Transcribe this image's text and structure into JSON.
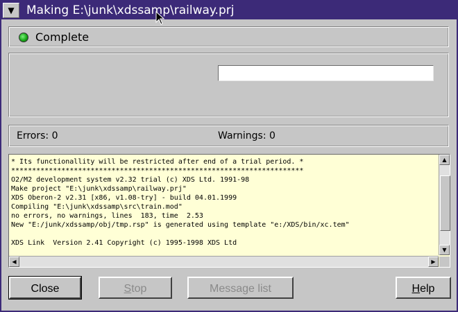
{
  "window": {
    "title": "Making E:\\junk\\xdssamp\\railway.prj"
  },
  "status": {
    "label": "Complete",
    "indicator_color": "#18a818"
  },
  "progress": {
    "fraction": 0
  },
  "counts": {
    "errors": "Errors: 0",
    "warnings": "Warnings: 0"
  },
  "log": {
    "lines": [
      "* Its functionallity will be restricted after end of a trial period. *",
      "**********************************************************************",
      "O2/M2 development system v2.32 trial (c) XDS Ltd. 1991-98",
      "Make project \"E:\\junk\\xdssamp\\railway.prj\"",
      "XDS Oberon-2 v2.31 [x86, v1.08-try] - build 04.01.1999",
      "Compiling \"E:\\junk\\xdssamp\\src\\train.mod\"",
      "no errors, no warnings, lines  183, time  2.53",
      "New \"E:/junk/xdssamp/obj/tmp.rsp\" is generated using template \"e:/XDS/bin/xc.tem\"",
      "",
      "XDS Link  Version 2.41 Copyright (c) 1995-1998 XDS Ltd"
    ]
  },
  "buttons": {
    "close": "Close",
    "stop_first": "S",
    "stop_rest": "top",
    "message_list": "Message list",
    "help_first": "H",
    "help_rest": "elp"
  },
  "colors": {
    "title_bar": "#3c2a78",
    "log_background": "#ffffd6"
  }
}
